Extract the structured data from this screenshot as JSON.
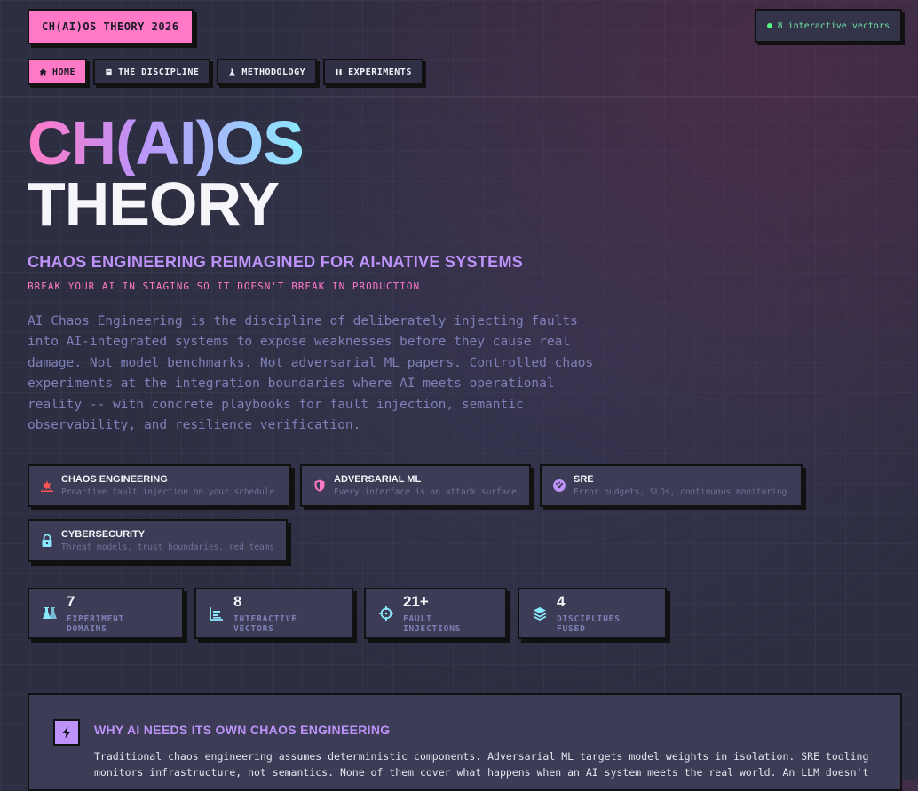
{
  "header": {
    "brand": "CH(AI)OS THEORY 2026",
    "status": "8 interactive vectors"
  },
  "nav": [
    {
      "label": "HOME",
      "icon": "home-icon",
      "active": true
    },
    {
      "label": "THE DISCIPLINE",
      "icon": "book-icon",
      "active": false
    },
    {
      "label": "METHODOLOGY",
      "icon": "flask-icon",
      "active": false
    },
    {
      "label": "EXPERIMENTS",
      "icon": "beaker-icon",
      "active": false
    }
  ],
  "hero": {
    "title_line1": "CH(AI)OS",
    "title_line2": "THEORY",
    "subtitle": "CHAOS ENGINEERING REIMAGINED FOR AI-NATIVE SYSTEMS",
    "tagline": "BREAK YOUR AI IN STAGING SO IT DOESN'T BREAK IN PRODUCTION",
    "description": "AI Chaos Engineering is the discipline of deliberately injecting faults into AI-integrated systems to expose weaknesses before they cause real damage. Not model benchmarks. Not adversarial ML papers. Controlled chaos experiments at the integration boundaries where AI meets operational reality -- with concrete playbooks for fault injection, semantic observability, and resilience verification."
  },
  "disciplines": [
    {
      "title": "CHAOS ENGINEERING",
      "sub": "Proactive fault injection on your schedule",
      "icon": "explosion-icon",
      "color": "#ff5555"
    },
    {
      "title": "ADVERSARIAL ML",
      "sub": "Every interface is an attack surface",
      "icon": "shield-icon",
      "color": "#ff79c6"
    },
    {
      "title": "SRE",
      "sub": "Error budgets, SLOs, continuous monitoring",
      "icon": "gauge-icon",
      "color": "#bd93f9"
    },
    {
      "title": "CYBERSECURITY",
      "sub": "Threat models, trust boundaries, red teams",
      "icon": "lock-icon",
      "color": "#8be9fd"
    }
  ],
  "stats": [
    {
      "value": "7",
      "label": "EXPERIMENT DOMAINS",
      "icon": "flask-icon"
    },
    {
      "value": "8",
      "label": "INTERACTIVE VECTORS",
      "icon": "chart-icon"
    },
    {
      "value": "21+",
      "label": "FAULT INJECTIONS",
      "icon": "crosshair-icon"
    },
    {
      "value": "4",
      "label": "DISCIPLINES FUSED",
      "icon": "layers-icon"
    }
  ],
  "panel": {
    "title": "WHY AI NEEDS ITS OWN CHAOS ENGINEERING",
    "text": "Traditional chaos engineering assumes deterministic components. Adversarial ML targets model weights in isolation. SRE tooling monitors infrastructure, not semantics. None of them cover what happens when an AI system meets the real world. An LLM doesn't"
  },
  "colors": {
    "pink": "#ff79c6",
    "purple": "#bd93f9",
    "cyan": "#8be9fd",
    "green": "#50fa7b",
    "background": "#2e2e42"
  }
}
